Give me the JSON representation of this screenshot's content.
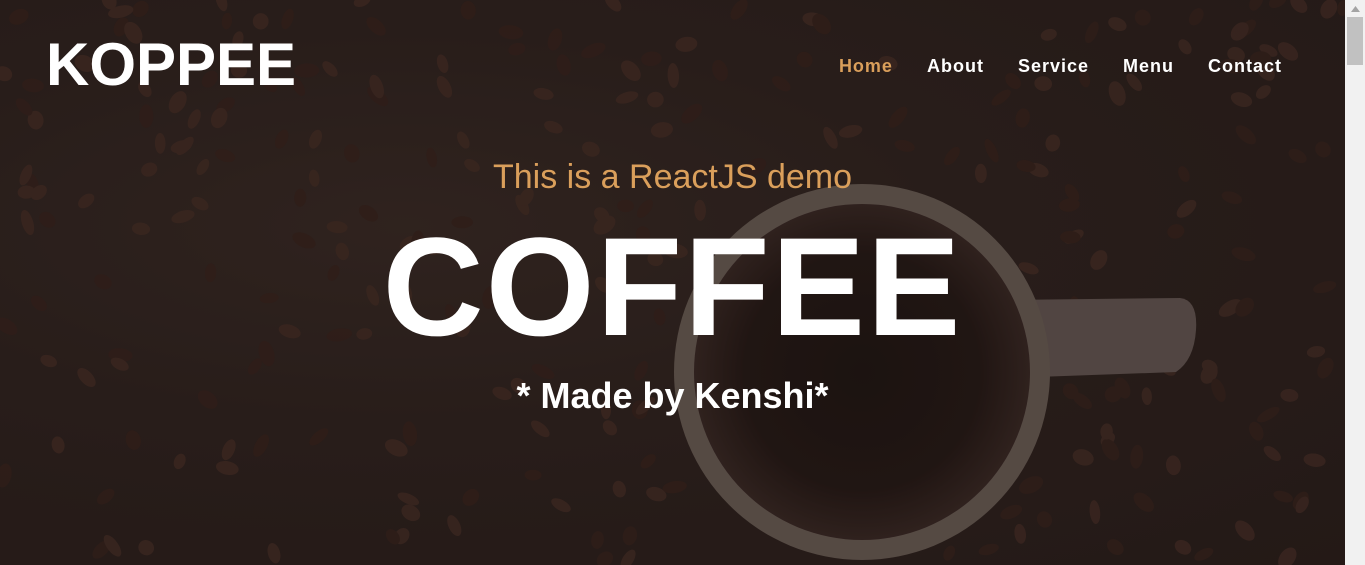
{
  "brand": {
    "name": "KOPPEE"
  },
  "nav": {
    "items": [
      {
        "label": "Home",
        "active": true
      },
      {
        "label": "About",
        "active": false
      },
      {
        "label": "Service",
        "active": false
      },
      {
        "label": "Menu",
        "active": false
      },
      {
        "label": "Contact",
        "active": false
      }
    ]
  },
  "hero": {
    "tagline": "This is a ReactJS demo",
    "headline": "COFFEE",
    "byline": "* Made by Kenshi*",
    "background_icon": "coffee-cup-and-beans-image"
  },
  "colors": {
    "accent": "#DA9F5B",
    "text": "#FFFFFF",
    "background": "#2B1F1C"
  }
}
